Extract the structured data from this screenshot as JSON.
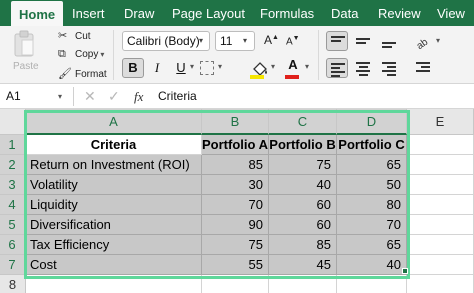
{
  "ribbon_tabs": [
    "Home",
    "Insert",
    "Draw",
    "Page Layout",
    "Formulas",
    "Data",
    "Review",
    "View"
  ],
  "clipboard": {
    "paste": "Paste",
    "cut": "Cut",
    "copy": "Copy",
    "format": "Format"
  },
  "font": {
    "name": "Calibri (Body)",
    "size": "11",
    "bold": "B",
    "italic": "I",
    "underline": "U",
    "font_color_letter": "A",
    "grow": "A",
    "shrink": "A"
  },
  "colors": {
    "ribbon_green": "#1f7346",
    "selection_outline": "#5fd79b",
    "fill_color": "#f6e600",
    "font_color": "#e0201b"
  },
  "formula_bar": {
    "name_box": "A1",
    "cancel_icon": "✕",
    "enter_icon": "✓",
    "fx": "fx",
    "value": "Criteria"
  },
  "columns": [
    "A",
    "B",
    "C",
    "D",
    "E"
  ],
  "rows": [
    "1",
    "2",
    "3",
    "4",
    "5",
    "6",
    "7",
    "8"
  ],
  "table": {
    "header": [
      "Criteria",
      "Portfolio A",
      "Portfolio B",
      "Portfolio C"
    ],
    "rows": [
      [
        "Return on Investment (ROI)",
        "85",
        "75",
        "65"
      ],
      [
        "Volatility",
        "30",
        "40",
        "50"
      ],
      [
        "Liquidity",
        "70",
        "60",
        "80"
      ],
      [
        "Diversification",
        "90",
        "60",
        "70"
      ],
      [
        "Tax Efficiency",
        "75",
        "85",
        "65"
      ],
      [
        "Cost",
        "55",
        "45",
        "40"
      ]
    ]
  },
  "icons": [
    "clipboard-icon",
    "scissors-icon",
    "copy-icon",
    "format-painter-icon",
    "borders-icon",
    "fill-color-icon",
    "font-color-icon",
    "align-top-icon",
    "align-middle-icon",
    "align-bottom-icon",
    "align-left-icon",
    "align-center-icon",
    "align-right-icon",
    "orientation-icon"
  ]
}
